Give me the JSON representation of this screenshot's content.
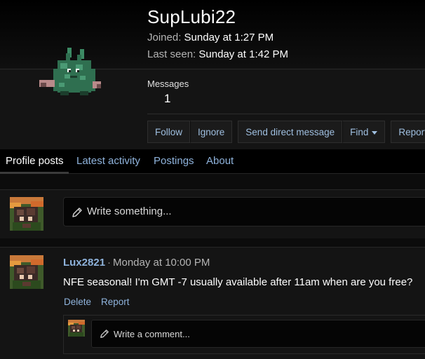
{
  "profile": {
    "username": "SupLubi22",
    "joined_label": "Joined:",
    "joined_value": "Sunday at 1:27 PM",
    "last_seen_label": "Last seen:",
    "last_seen_value": "Sunday at 1:42 PM",
    "messages_label": "Messages",
    "messages_value": "1"
  },
  "actions": {
    "follow": "Follow",
    "ignore": "Ignore",
    "send_dm": "Send direct message",
    "find": "Find",
    "report": "Report"
  },
  "tabs": [
    {
      "label": "Profile posts",
      "active": true
    },
    {
      "label": "Latest activity",
      "active": false
    },
    {
      "label": "Postings",
      "active": false
    },
    {
      "label": "About",
      "active": false
    }
  ],
  "composer": {
    "placeholder": "Write something..."
  },
  "post": {
    "author": "Lux2821",
    "separator": "·",
    "time": "Monday at 10:00 PM",
    "body": "NFE seasonal! I'm GMT -7 usually available after 11am when are you free?",
    "delete_label": "Delete",
    "report_label": "Report",
    "comment_placeholder": "Write a comment..."
  },
  "icons": {
    "pencil": "pencil-icon",
    "caret": "caret-down-icon"
  },
  "colors": {
    "link": "#8fb3dc",
    "button_text": "#9fbfe0",
    "background": "#0c0c0c",
    "panel": "#141414"
  }
}
